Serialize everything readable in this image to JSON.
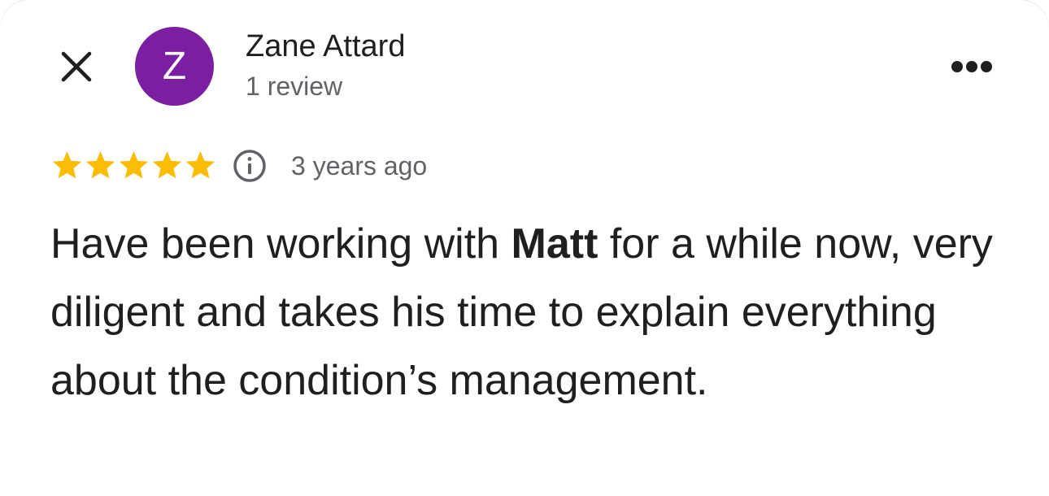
{
  "reviewer": {
    "initial": "Z",
    "name": "Zane Attard",
    "review_count": "1 review",
    "avatar_color": "#7b1fa2"
  },
  "review": {
    "rating": 5,
    "max_rating": 5,
    "time_ago": "3 years ago",
    "text_before": "Have been working with ",
    "text_bold": "Matt",
    "text_after": " for a while now, very diligent and takes his time to explain everything about the condition’s management."
  },
  "colors": {
    "star": "#fbbc04",
    "secondary_text": "#5f6368",
    "primary_text": "#1f1f1f"
  },
  "icons": {
    "close": "close-icon",
    "more": "more-horiz-icon",
    "info": "info-icon",
    "star": "star-icon"
  }
}
